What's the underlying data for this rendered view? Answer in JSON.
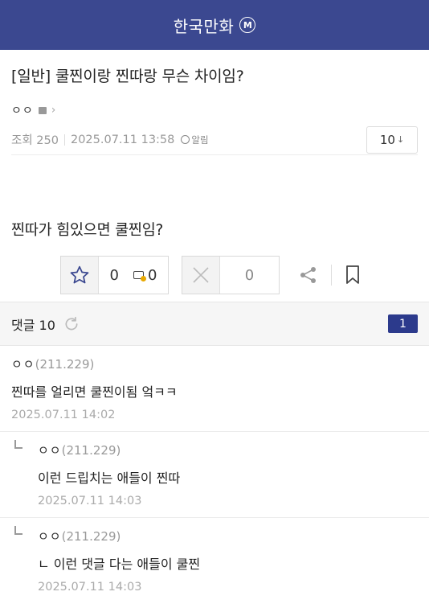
{
  "header": {
    "title": "한국만화",
    "badge": "M"
  },
  "post": {
    "title": "[일반] 쿨찐이랑 찐따랑 무슨 차이임?",
    "author": "ㅇㅇ",
    "views": "조회 250",
    "date": "2025.07.11 13:58",
    "alert_label": "알림",
    "font_size": "10",
    "body": "찐따가 힘있으면 쿨찐임?"
  },
  "votes": {
    "up_count": "0",
    "gold_count": "0",
    "down_count": "0"
  },
  "comments_header": {
    "label": "댓글 10",
    "page": "1"
  },
  "comments": [
    {
      "author": "ㅇㅇ",
      "ip": "(211.229)",
      "text": "찐따를 얼리면 쿨찐이됨 엌ㅋㅋ",
      "date": "2025.07.11 14:02",
      "reply": false
    },
    {
      "author": "ㅇㅇ",
      "ip": "(211.229)",
      "text": "이런 드립치는 애들이 찐따",
      "date": "2025.07.11 14:03",
      "reply": true
    },
    {
      "author": "ㅇㅇ",
      "ip": "(211.229)",
      "text": "ㄴ 이런 댓글 다는 애들이 쿨찐",
      "date": "2025.07.11 14:03",
      "reply": true
    }
  ],
  "colors": {
    "header_bg": "#3b4890",
    "page_badge": "#2c3a8c",
    "gold_coin": "#e8a800"
  },
  "icons": [
    "star-icon",
    "gold-icon",
    "x-icon",
    "share-icon",
    "bookmark-icon",
    "refresh-icon",
    "bell-icon",
    "chevron-right-icon"
  ]
}
